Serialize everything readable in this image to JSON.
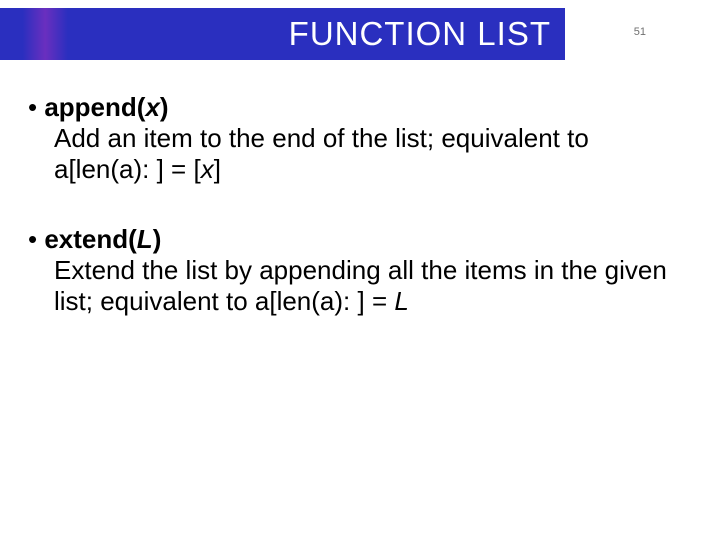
{
  "header": {
    "title": "FUNCTION LIST",
    "page": "51"
  },
  "items": [
    {
      "bullet": "• ",
      "fn": "append(",
      "arg": "x",
      "close": ")",
      "desc_a": "Add an item to the end of the list; equivalent to a[len(a): ] = [",
      "desc_ital": "x",
      "desc_b": "]"
    },
    {
      "bullet": "• ",
      "fn": "extend(",
      "arg": "L",
      "close": ")",
      "desc_a": "Extend the list by appending all the items in the given list; equivalent to a[len(a): ] = ",
      "desc_ital": "L",
      "desc_b": ""
    }
  ]
}
